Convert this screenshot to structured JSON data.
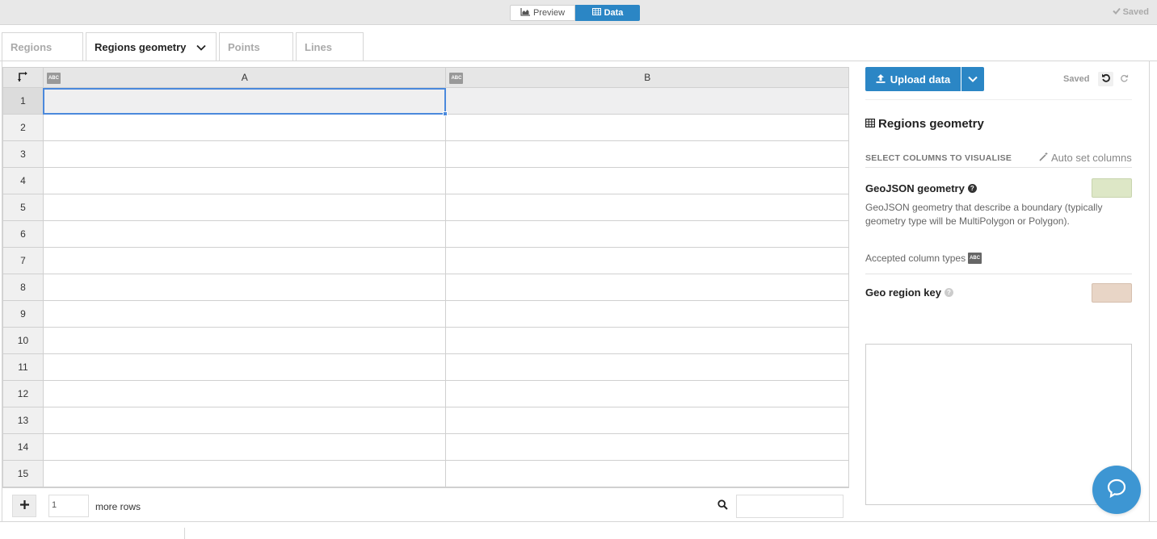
{
  "topbar": {
    "preview_label": "Preview",
    "data_label": "Data",
    "saved_label": "Saved"
  },
  "tabs": [
    {
      "label": "Regions",
      "active": false
    },
    {
      "label": "Regions geometry",
      "active": true
    },
    {
      "label": "Points",
      "active": false
    },
    {
      "label": "Lines",
      "active": false
    }
  ],
  "grid": {
    "columns": [
      {
        "header": "A",
        "type_badge": "ABC"
      },
      {
        "header": "B",
        "type_badge": "ABC"
      }
    ],
    "row_numbers": [
      "1",
      "2",
      "3",
      "4",
      "5",
      "6",
      "7",
      "8",
      "9",
      "10",
      "11",
      "12",
      "13",
      "14",
      "15"
    ],
    "selected_row": "1",
    "selected_cell": "A1"
  },
  "footer": {
    "rows_value": "1",
    "more_rows_label": "more rows",
    "search_value": ""
  },
  "side": {
    "upload_label": "Upload data",
    "saved_label": "Saved",
    "title": "Regions geometry",
    "select_columns_label": "SELECT COLUMNS TO VISUALISE",
    "auto_set_label": "Auto set columns",
    "geojson": {
      "title": "GeoJSON geometry",
      "description": "GeoJSON geometry that describe a boundary (typically geometry type will be MultiPolygon or Polygon).",
      "accepted_label": "Accepted column types",
      "accepted_badge": "ABC",
      "color": "#dde7c6"
    },
    "geo_key": {
      "title": "Geo region key",
      "color": "#e8d5c6"
    }
  },
  "colors": {
    "accent": "#2b86c5",
    "selection": "#4b89dc",
    "chat": "#3d96d3"
  },
  "icons": [
    "chart-icon",
    "table-icon",
    "check-icon",
    "chevron-down-icon",
    "transpose-icon",
    "plus-icon",
    "search-icon",
    "upload-icon",
    "undo-icon",
    "redo-icon",
    "wand-icon",
    "help-icon",
    "chat-icon"
  ]
}
